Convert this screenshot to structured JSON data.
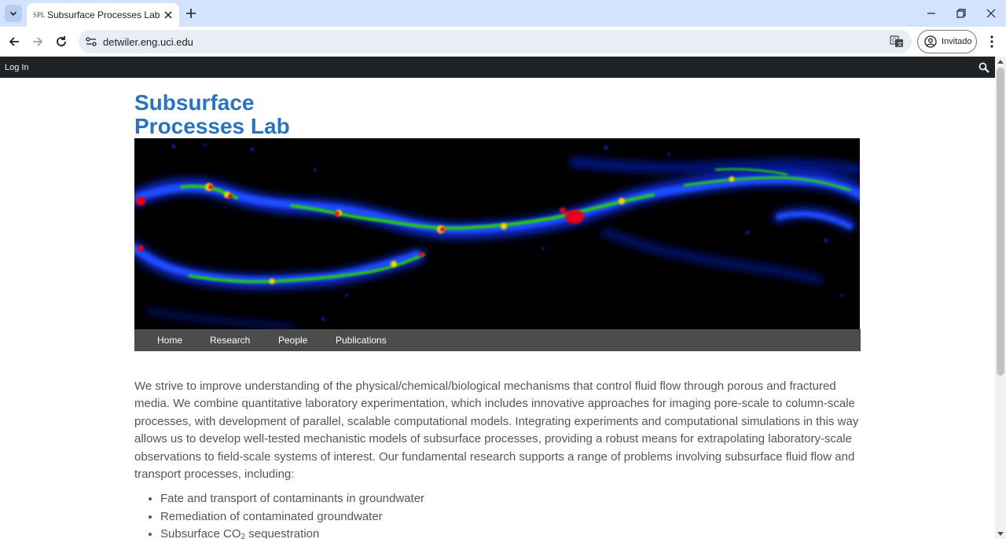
{
  "browser": {
    "tab_title": "Subsurface Processes Lab",
    "favicon_text": "SPL",
    "url": "detwiler.eng.uci.edu",
    "profile_label": "Invitado"
  },
  "adminbar": {
    "login_label": "Log In"
  },
  "site": {
    "title_line1": "Subsurface",
    "title_line2": "Processes Lab"
  },
  "nav": {
    "items": [
      "Home",
      "Research",
      "People",
      "Publications"
    ]
  },
  "content": {
    "intro": "We strive to improve understanding of the physical/chemical/biological mechanisms that control fluid flow through porous and fractured media. We combine quantitative laboratory experimentation, which includes innovative approaches for imaging pore-scale to column-scale processes, with development of parallel, scalable computational models. Integrating experiments and computational simulations in this way allows us to develop well-tested mechanistic models of subsurface processes, providing a robust means for extrapolating laboratory-scale observations to field-scale systems of interest. Our fundamental research supports a range of problems involving subsurface fluid flow and transport processes, including:",
    "list": [
      "Fate and transport of contaminants in groundwater",
      "Remediation of contaminated groundwater"
    ],
    "list3_prefix": "Subsurface CO",
    "list3_sub": "2",
    "list3_suffix": " sequestration"
  },
  "colors": {
    "title": "#2a74bd",
    "nav_bg": "#4c4c4c",
    "adminbar_bg": "#1d2327",
    "tabstrip_bg": "#d3e3fd"
  },
  "icons": [
    "tab-list-icon",
    "close-icon",
    "plus-icon",
    "minimize-icon",
    "restore-icon",
    "back-icon",
    "forward-icon",
    "reload-icon",
    "site-info-icon",
    "translate-icon",
    "profile-icon",
    "menu-icon",
    "search-icon"
  ]
}
